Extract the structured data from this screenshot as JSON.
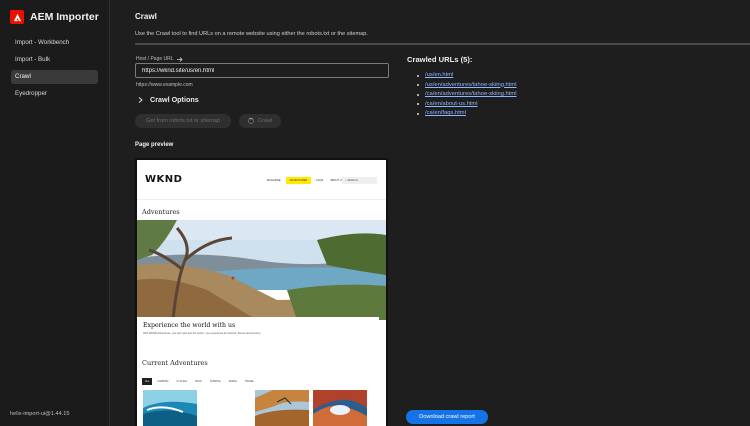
{
  "app": {
    "title": "AEM Importer",
    "version": "helix-import-ui@1.44.15"
  },
  "sidebar": {
    "items": [
      {
        "label": "Import - Workbench",
        "active": false
      },
      {
        "label": "Import - Bulk",
        "active": false
      },
      {
        "label": "Crawl",
        "active": true
      },
      {
        "label": "Eyedropper",
        "active": false
      }
    ]
  },
  "crawl": {
    "title": "Crawl",
    "description": "Use the Crawl tool to find URLs on a remote website using either the robots.txt or the sitemap.",
    "url_label": "Host / Page URL",
    "url_value": "https://wknd.site/us/en.html",
    "help_text": "https://www.example.com",
    "options_label": "Crawl Options",
    "robots_button": "Get from robots.txt or sitemap",
    "crawl_button": "Crawl",
    "preview_label": "Page preview"
  },
  "preview": {
    "logo": "WKND",
    "nav": [
      "MAGAZINE",
      "ADVENTURES",
      "FAQS",
      "ABOUT US"
    ],
    "nav_highlight": "ADVENTURES",
    "search_placeholder": "SEARCH",
    "adventures_title": "Adventures",
    "card_title": "Experience the world with us",
    "card_text": "With WKND Adventures, you don't just see the world - you experience its cultures, flavors and scenery.",
    "current_title": "Current Adventures",
    "filters": [
      "ALL",
      "CAMPING",
      "CYCLING",
      "ROCK",
      "SURFING",
      "SKIING",
      "TRAVEL"
    ],
    "filter_selected": "ALL"
  },
  "results": {
    "title": "Crawled URLs (5):",
    "urls": [
      "/us/en.html",
      "/us/en/adventures/tahoe-skiing.html",
      "/ca/en/adventures/tahoe-skiing.html",
      "/ca/en/about-us.html",
      "/ca/en/faqs.html"
    ],
    "download_button": "Download crawl report"
  },
  "colors": {
    "accent": "#1473e6",
    "brand": "#eb1000",
    "link": "#8fb6ff",
    "highlight": "#ffea00"
  }
}
